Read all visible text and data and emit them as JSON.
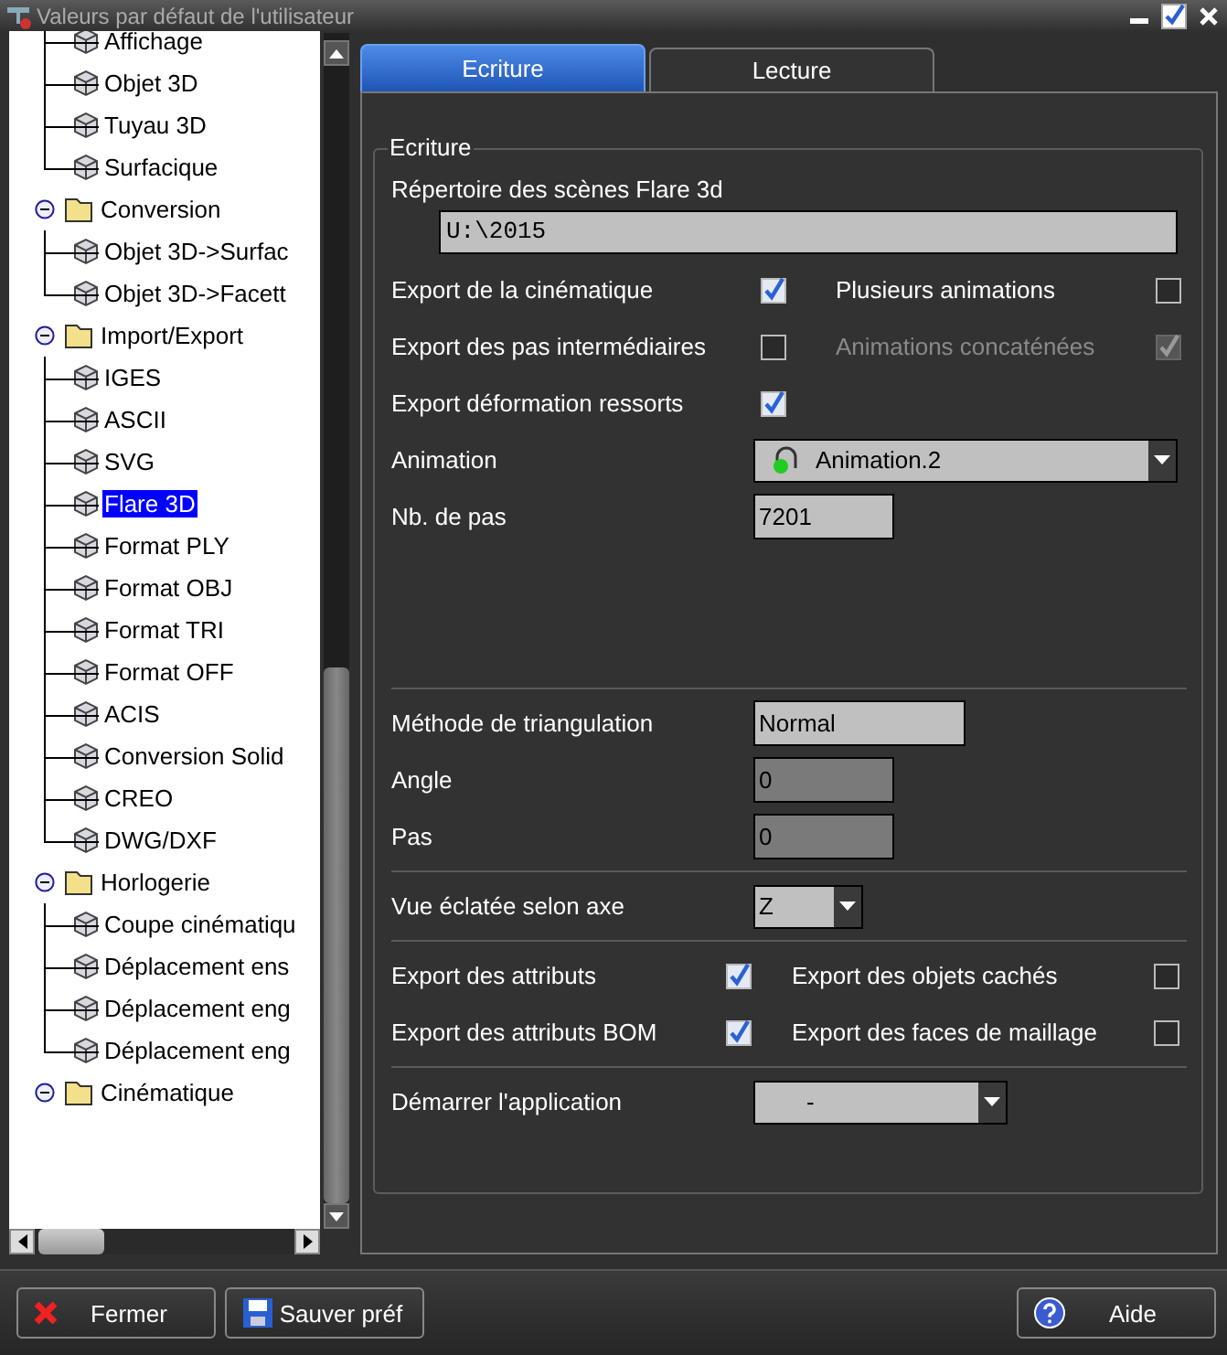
{
  "window": {
    "title": "Valeurs par défaut de l'utilisateur"
  },
  "tree": [
    {
      "children": [
        {
          "label": "Affichage",
          "selected": false
        },
        {
          "label": "Objet 3D",
          "selected": false
        },
        {
          "label": "Tuyau 3D",
          "selected": false
        },
        {
          "label": "Surfacique",
          "selected": false
        }
      ]
    },
    {
      "label": "Conversion",
      "expanded": true,
      "children": [
        {
          "label": "Objet 3D->Surfac",
          "selected": false
        },
        {
          "label": "Objet 3D->Facett",
          "selected": false
        }
      ]
    },
    {
      "label": "Import/Export",
      "expanded": true,
      "children": [
        {
          "label": "IGES",
          "selected": false
        },
        {
          "label": "ASCII",
          "selected": false
        },
        {
          "label": "SVG",
          "selected": false
        },
        {
          "label": "Flare 3D",
          "selected": true
        },
        {
          "label": "Format PLY",
          "selected": false
        },
        {
          "label": "Format OBJ",
          "selected": false
        },
        {
          "label": "Format TRI",
          "selected": false
        },
        {
          "label": "Format OFF",
          "selected": false
        },
        {
          "label": "ACIS",
          "selected": false
        },
        {
          "label": "Conversion Solid",
          "selected": false
        },
        {
          "label": "CREO",
          "selected": false
        },
        {
          "label": "DWG/DXF",
          "selected": false
        }
      ]
    },
    {
      "label": "Horlogerie",
      "expanded": true,
      "children": [
        {
          "label": "Coupe cinématiqu",
          "selected": false
        },
        {
          "label": "Déplacement ens",
          "selected": false
        },
        {
          "label": "Déplacement eng",
          "selected": false
        },
        {
          "label": "Déplacement eng",
          "selected": false
        }
      ]
    },
    {
      "label": "Cinématique",
      "expanded": true
    }
  ],
  "tabs": [
    {
      "label": "Ecriture",
      "selected": true
    },
    {
      "label": "Lecture",
      "selected": false
    }
  ],
  "form": {
    "legend": "Ecriture",
    "sections": [
      {
        "rows": [
          {
            "kind": "path",
            "label": "Répertoire des scènes Flare 3d",
            "value": "U:\\2015"
          },
          {
            "kind": "checks",
            "items": [
              {
                "label": "Export de la cinématique",
                "checked": true,
                "disabled": false
              },
              {
                "label": "Plusieurs animations",
                "checked": false,
                "disabled": false
              }
            ]
          },
          {
            "kind": "checks",
            "items": [
              {
                "label": "Export des pas intermédiaires",
                "checked": false,
                "disabled": false
              },
              {
                "label": "Animations concaténées",
                "checked": true,
                "disabled": true
              }
            ]
          },
          {
            "kind": "checks",
            "items": [
              {
                "label": "Export déformation ressorts",
                "checked": true,
                "disabled": false
              }
            ]
          },
          {
            "kind": "dropdown-wide",
            "label": "Animation",
            "value": "Animation.2"
          },
          {
            "kind": "field",
            "label": "Nb. de pas",
            "value": "7201",
            "disabled": false
          }
        ]
      },
      {
        "rows": [
          {
            "kind": "field-wide",
            "label": "Méthode de triangulation",
            "value": "Normal",
            "disabled": false
          },
          {
            "kind": "field",
            "label": "Angle",
            "value": "0",
            "disabled": true
          },
          {
            "kind": "field",
            "label": "Pas",
            "value": "0",
            "disabled": true
          }
        ]
      },
      {
        "rows": [
          {
            "kind": "dropdown-small",
            "label": "Vue éclatée selon axe",
            "value": "Z"
          }
        ]
      },
      {
        "rows": [
          {
            "kind": "checks-tight",
            "items": [
              {
                "label": "Export des attributs",
                "checked": true,
                "disabled": false
              },
              {
                "label": "Export des objets cachés",
                "checked": false,
                "disabled": false
              }
            ]
          },
          {
            "kind": "checks-tight",
            "items": [
              {
                "label": "Export des attributs BOM",
                "checked": true,
                "disabled": false
              },
              {
                "label": "Export des faces de maillage",
                "checked": false,
                "disabled": false
              }
            ]
          }
        ]
      },
      {
        "rows": [
          {
            "kind": "dropdown-medium",
            "label": "Démarrer l'application",
            "value": "-"
          }
        ]
      }
    ]
  },
  "buttons": [
    {
      "label": "Fermer",
      "kind": "close"
    },
    {
      "label": "Sauver préf",
      "kind": "save"
    },
    {
      "label": "Aide",
      "kind": "help"
    }
  ]
}
